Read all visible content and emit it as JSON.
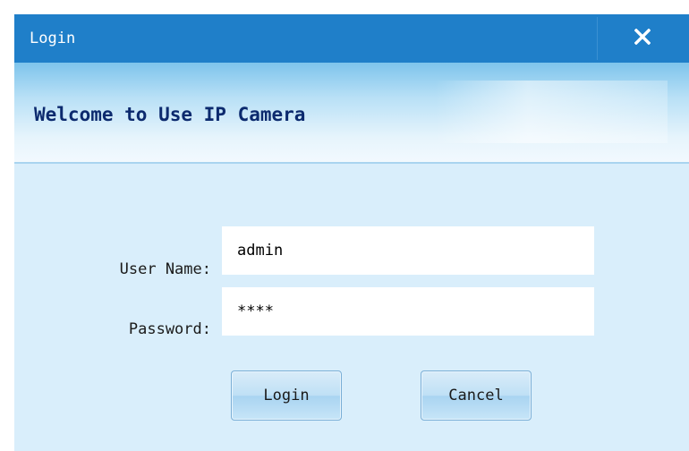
{
  "window": {
    "title": "Login"
  },
  "banner": {
    "welcome_text": "Welcome to Use IP Camera"
  },
  "form": {
    "username_label": "User Name:",
    "username_value": "admin",
    "password_label": "Password:",
    "password_value": "****"
  },
  "buttons": {
    "login_label": "Login",
    "cancel_label": "Cancel"
  },
  "icons": {
    "close": "close-icon"
  },
  "colors": {
    "titlebar": "#1f7fc9",
    "dialog_bg": "#d9eefb",
    "welcome_text": "#0c2a6e"
  }
}
